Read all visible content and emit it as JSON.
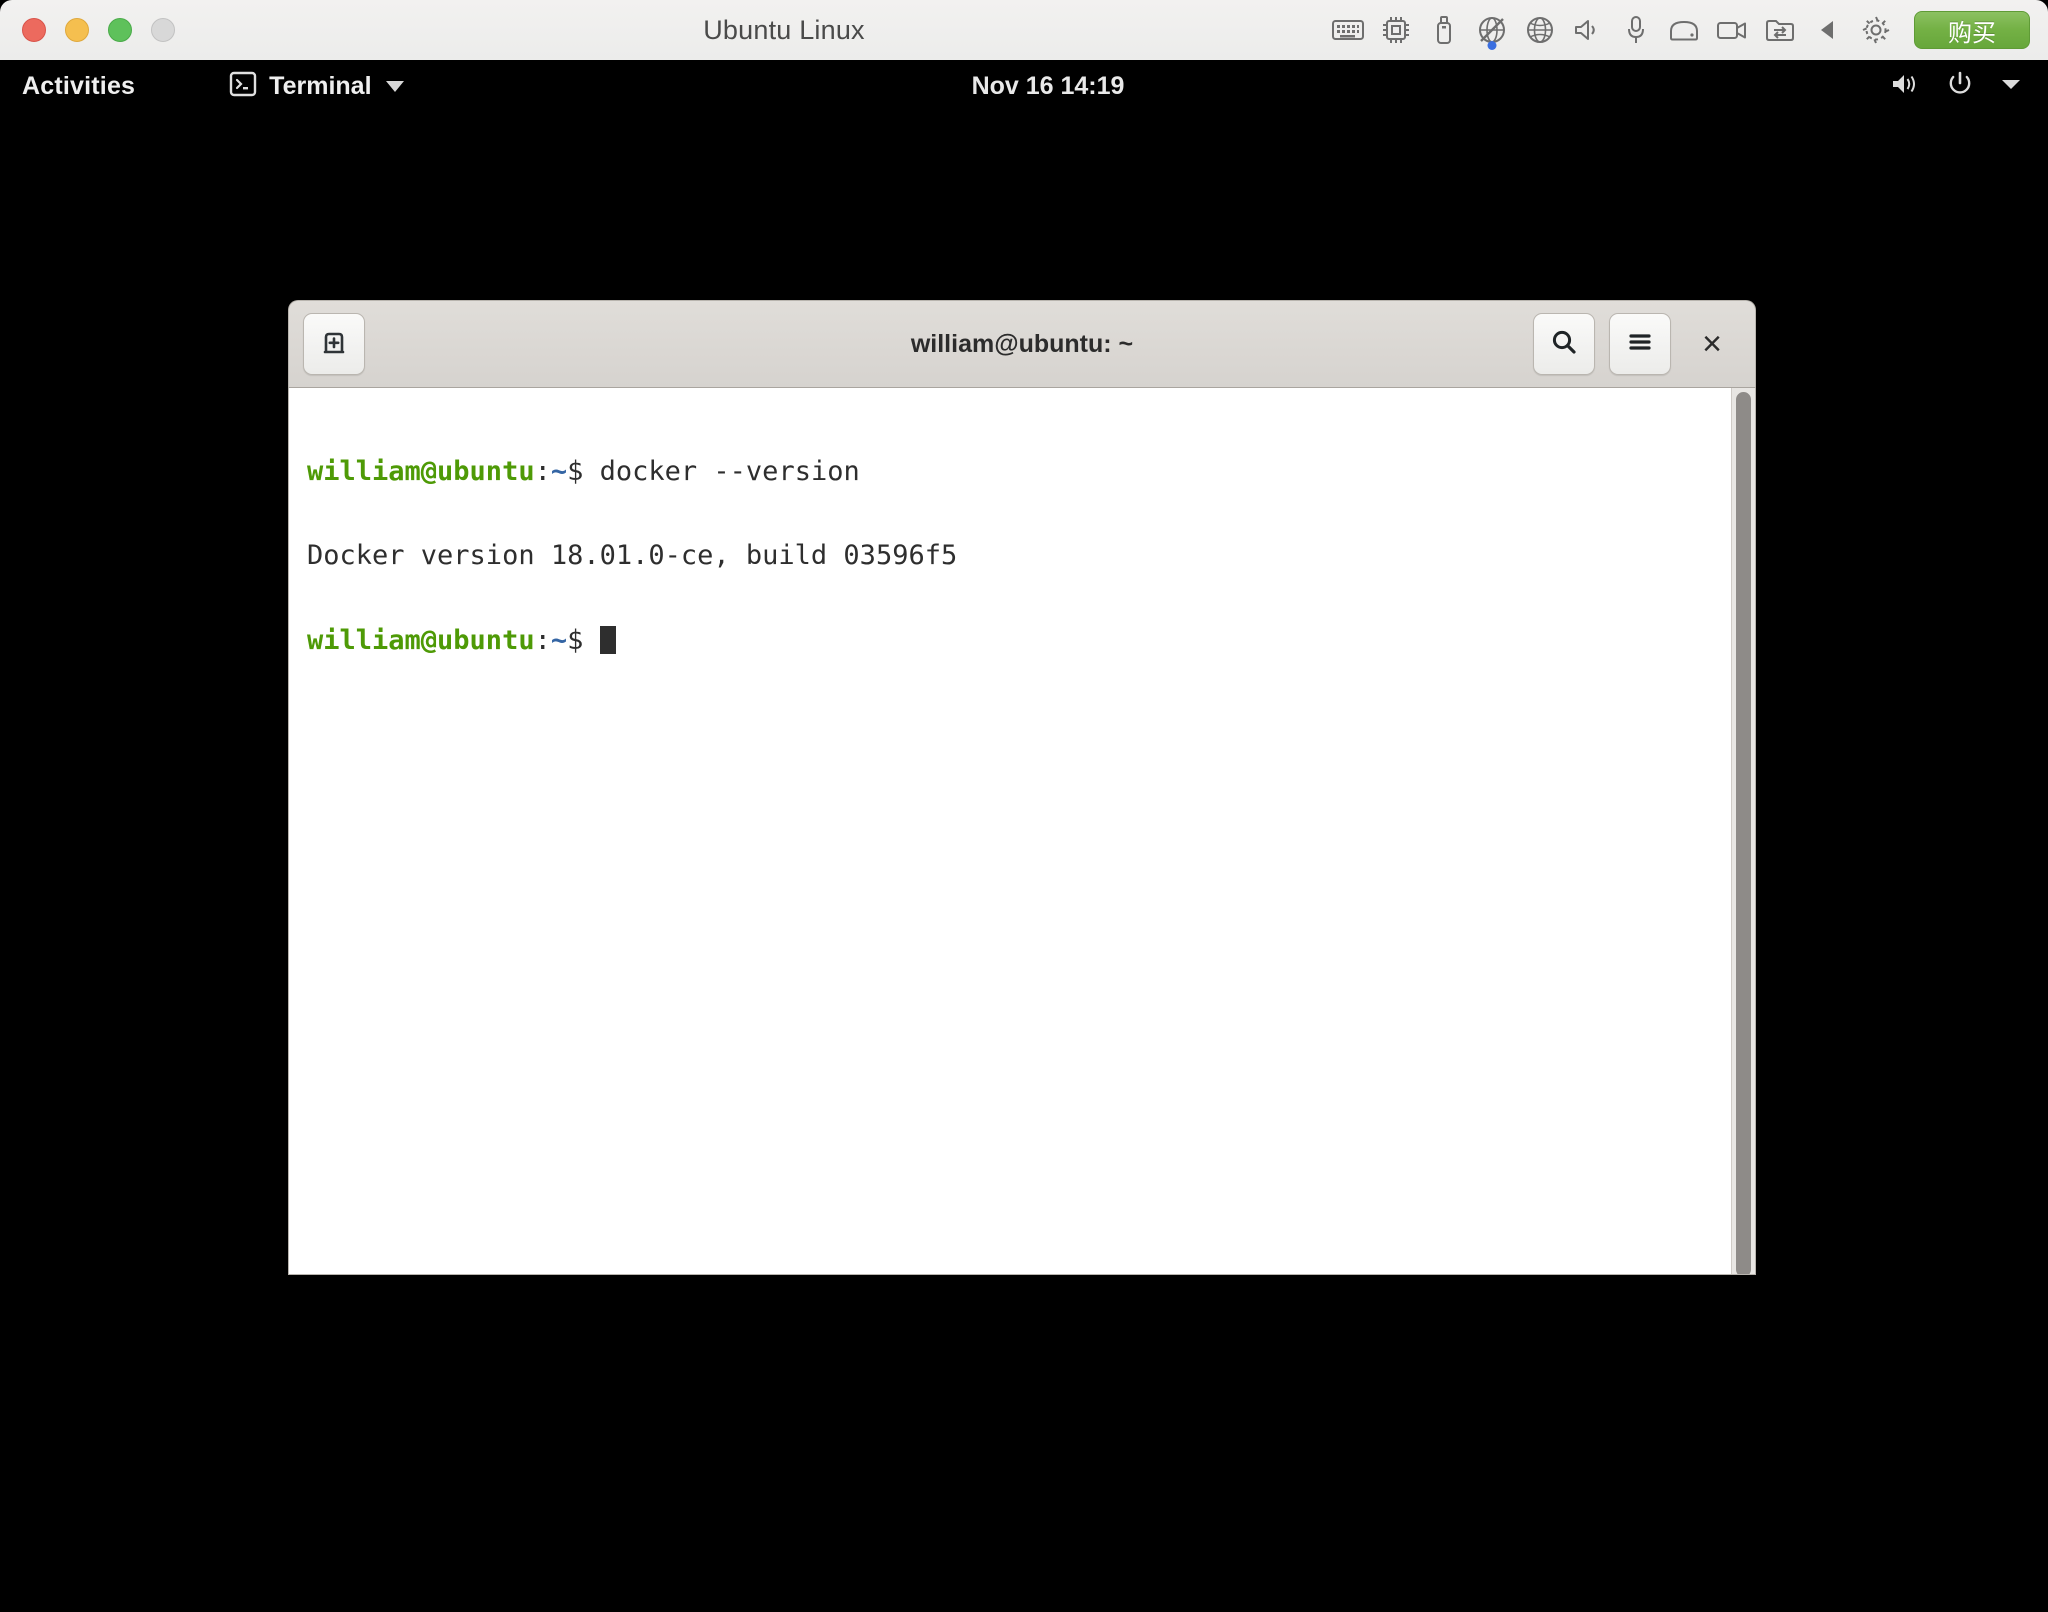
{
  "host_window": {
    "title": "Ubuntu Linux",
    "traffic_lights": [
      {
        "name": "close",
        "color": "#ec6a5e"
      },
      {
        "name": "minimize",
        "color": "#f5bf4f"
      },
      {
        "name": "zoom",
        "color": "#5ec15b"
      },
      {
        "name": "disabled",
        "color": "#d8d8d8"
      }
    ],
    "toolbar_icons": [
      "keyboard-icon",
      "cpu-icon",
      "usb-icon",
      "network-disabled-icon",
      "globe-icon",
      "speaker-icon",
      "microphone-icon",
      "disk-icon",
      "camera-icon",
      "shared-folder-icon",
      "play-back-icon",
      "gear-icon"
    ],
    "buy_button_label": "购买",
    "buy_button_color": "#74b145",
    "network_activity_dot_color": "#3b6fe0"
  },
  "gnome_panel": {
    "activities_label": "Activities",
    "app_menu_label": "Terminal",
    "app_icon": "terminal-icon",
    "clock": "Nov 16  14:19",
    "status_icons": [
      "volume-icon",
      "power-icon",
      "chevron-down-icon"
    ]
  },
  "terminal_window": {
    "title": "william@ubuntu: ~",
    "new_tab_icon": "new-tab-icon",
    "search_icon": "search-icon",
    "menu_icon": "hamburger-menu-icon",
    "close_label": "×",
    "background_color": "#ffffff",
    "prompt_color": "#4e9a06",
    "path_color": "#3465a4",
    "text_color": "#2e2e2e",
    "lines": [
      {
        "type": "prompt",
        "user_host": "william@ubuntu",
        "separator": ":",
        "path": "~",
        "sigil": "$",
        "command": " docker --version"
      },
      {
        "type": "output",
        "text": "Docker version 18.01.0-ce, build 03596f5"
      },
      {
        "type": "prompt",
        "user_host": "william@ubuntu",
        "separator": ":",
        "path": "~",
        "sigil": "$",
        "command": " "
      }
    ],
    "scrollbar": {
      "thumb_color": "#8e8b88",
      "track_color": "#e8e6e3"
    }
  }
}
